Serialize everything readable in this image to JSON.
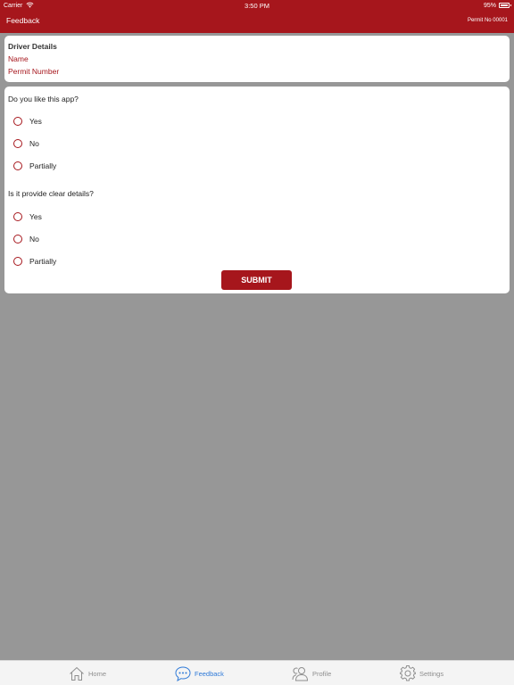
{
  "status_bar": {
    "carrier": "Carrier",
    "time": "3:50 PM",
    "battery": "95%"
  },
  "header": {
    "title": "Feedback",
    "permit": "Permit No 00001"
  },
  "driver": {
    "title": "Driver Details",
    "name_label": "Name",
    "permit_label": "Permit Number"
  },
  "questions": [
    {
      "text": "Do you like this app?",
      "options": [
        "Yes",
        "No",
        "Partially"
      ]
    },
    {
      "text": "Is it provide clear details?",
      "options": [
        "Yes",
        "No",
        "Partially"
      ]
    }
  ],
  "submit_label": "SUBMIT",
  "tabs": [
    {
      "label": "Home",
      "icon": "home-icon",
      "active": false
    },
    {
      "label": "Feedback",
      "icon": "chat-bubble-icon",
      "active": true
    },
    {
      "label": "Profile",
      "icon": "profile-icon",
      "active": false
    },
    {
      "label": "Settings",
      "icon": "gear-icon",
      "active": false
    }
  ],
  "colors": {
    "brand": "#a6161c",
    "active_tab": "#2f7ad8",
    "background": "#979797"
  }
}
